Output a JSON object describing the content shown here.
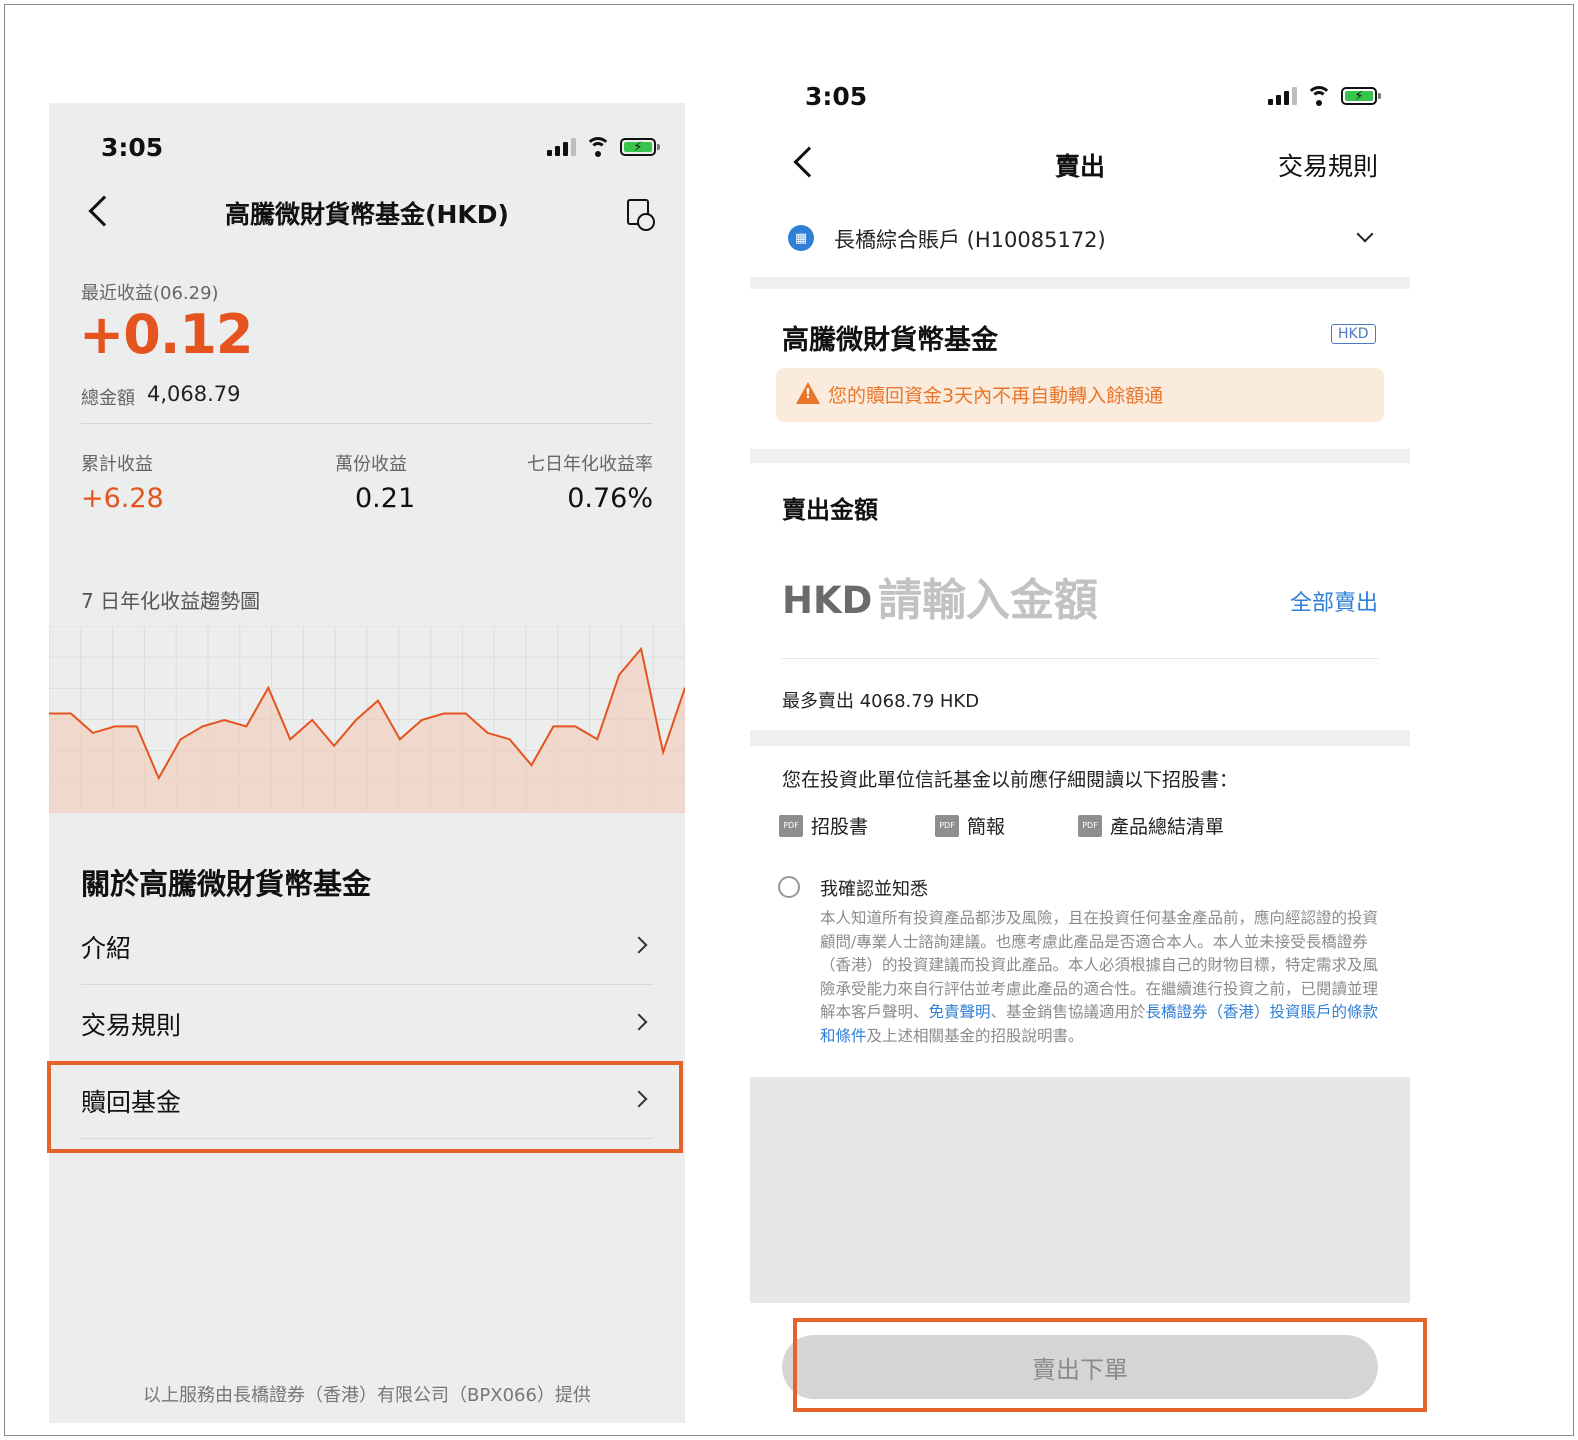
{
  "left": {
    "status_time": "3:05",
    "title": "高騰微財貨幣基金(HKD)",
    "recent_label": "最近收益(06.29)",
    "recent_value": "+0.12",
    "total_label": "總金額",
    "total_value": "4,068.79",
    "stats": [
      {
        "label": "累計收益",
        "value": "+6.28"
      },
      {
        "label": "萬份收益",
        "value": "0.21"
      },
      {
        "label": "七日年化收益率",
        "value": "0.76%"
      }
    ],
    "chart_title": "7 日年化收益趨勢圖",
    "section_title": "關於高騰微財貨幣基金",
    "rows": [
      {
        "label": "介紹"
      },
      {
        "label": "交易規則"
      },
      {
        "label": "贖回基金"
      }
    ],
    "footer": "以上服務由長橋證券（香港）有限公司（BPX066）提供"
  },
  "right": {
    "status_time": "3:05",
    "title": "賣出",
    "rules_link": "交易規則",
    "account": "長橋綜合賬戶 (H10085172)",
    "fund_name": "高騰微財貨幣基金",
    "currency_badge": "HKD",
    "warning": "您的贖回資金3天內不再自動轉入餘額通",
    "amount_title": "賣出金額",
    "currency": "HKD",
    "amount_placeholder": "請輸入金額",
    "sell_all": "全部賣出",
    "max_sell": "最多賣出 4068.79 HKD",
    "prospectus_intro": "您在投資此單位信託基金以前應仔細閱讀以下招股書：",
    "docs": [
      "招股書",
      "簡報",
      "產品總結清單"
    ],
    "pdf_tag": "PDF",
    "confirm_label": "我確認並知悉",
    "disclaimer_a": "本人知道所有投資產品都涉及風險，且在投資任何基金產品前，應向經認證的投資顧問/專業人士諮詢建議。也應考慮此產品是否適合本人。本人並未接受長橋證券（香港）的投資建議而投資此產品。本人必須根據自己的財物目標，特定需求及風險承受能力來自行評估並考慮此產品的適合性。在繼續進行投資之前，已閱讀並理解本客戶聲明、",
    "disclaimer_link1": "免責聲明",
    "disclaimer_b": "、基金銷售協議適用於",
    "disclaimer_link2": "長橋證券（香港）投資賬戶的條款和條件",
    "disclaimer_c": "及上述相關基金的招股說明書。",
    "submit": "賣出下單"
  },
  "chart_data": {
    "type": "area",
    "title": "7 日年化收益趨勢圖",
    "series": [
      {
        "values": [
          0.74,
          0.74,
          0.71,
          0.72,
          0.72,
          0.64,
          0.7,
          0.72,
          0.73,
          0.72,
          0.78,
          0.7,
          0.73,
          0.69,
          0.73,
          0.76,
          0.7,
          0.73,
          0.74,
          0.74,
          0.71,
          0.7,
          0.66,
          0.72,
          0.72,
          0.7,
          0.8,
          0.84,
          0.68,
          0.78
        ]
      }
    ],
    "colors": {
      "line": "#e5531f",
      "fill": "#f3c9b6"
    },
    "grid": true
  }
}
